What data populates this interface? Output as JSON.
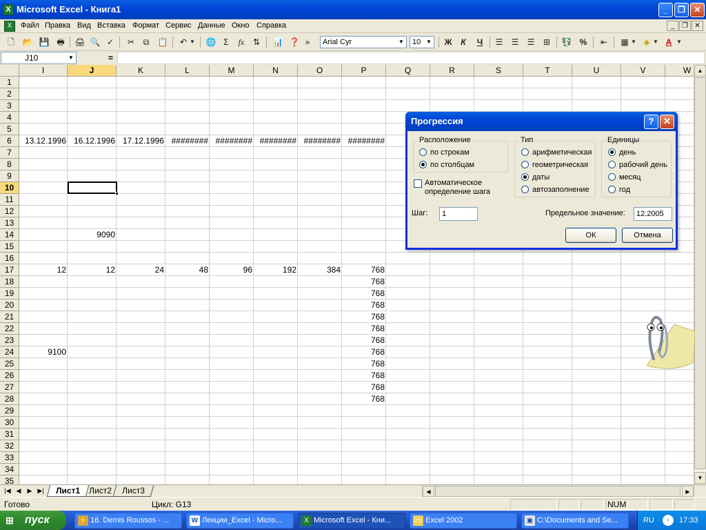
{
  "window": {
    "title": "Microsoft Excel - Книга1",
    "minimize": "_",
    "restore": "❐",
    "close": "✕"
  },
  "menu": {
    "items": [
      "Файл",
      "Правка",
      "Вид",
      "Вставка",
      "Формат",
      "Сервис",
      "Данные",
      "Окно",
      "Справка"
    ],
    "mdi": [
      "_",
      "❐",
      "✕"
    ]
  },
  "toolbar": {
    "font_name": "Arial Cyr",
    "font_size": "10",
    "bold": "Ж",
    "italic": "К",
    "underline": "Ч",
    "sum": "Σ",
    "fx": "fx",
    "percent": "%",
    "chevron": "»"
  },
  "formula_bar": {
    "cell_ref": "J10",
    "equals": "=",
    "value": ""
  },
  "grid": {
    "columns": [
      "I",
      "J",
      "K",
      "L",
      "M",
      "N",
      "O",
      "P",
      "Q",
      "R",
      "S",
      "T",
      "U",
      "V",
      "W"
    ],
    "active_column": "J",
    "rows": [
      "1",
      "2",
      "3",
      "4",
      "5",
      "6",
      "7",
      "8",
      "9",
      "10",
      "11",
      "12",
      "13",
      "14",
      "15",
      "16",
      "17",
      "18",
      "19",
      "20",
      "21",
      "22",
      "23",
      "24",
      "25",
      "26",
      "27",
      "28",
      "29",
      "30",
      "31",
      "32",
      "33",
      "34",
      "35"
    ],
    "active_row": "10",
    "row6": [
      "13.12.1996",
      "16.12.1996",
      "17.12.1996",
      "########",
      "########",
      "########",
      "########",
      "########",
      "###"
    ],
    "row14_J": "9090",
    "row17": [
      "12",
      "12",
      "24",
      "48",
      "96",
      "192",
      "384",
      "768"
    ],
    "colP_rows18_28": [
      "768",
      "768",
      "768",
      "768",
      "768",
      "768",
      "768",
      "768",
      "768",
      "768",
      "768"
    ],
    "row24_I": "9100"
  },
  "sheets": {
    "tabs": [
      "Лист1",
      "Лист2",
      "Лист3"
    ],
    "active": "Лист1"
  },
  "status": {
    "ready": "Готово",
    "cycle": "Цикл: G13",
    "num": "NUM"
  },
  "dialog": {
    "title": "Прогрессия",
    "help": "?",
    "close": "✕",
    "layout_group": "Расположение",
    "layout_options": [
      "по строкам",
      "по столбцам"
    ],
    "layout_selected": 1,
    "type_group": "Тип",
    "type_options": [
      "арифметическая",
      "геометрическая",
      "даты",
      "автозаполнение"
    ],
    "type_selected": 2,
    "units_group": "Единицы",
    "units_options": [
      "день",
      "рабочий день",
      "месяц",
      "год"
    ],
    "units_selected": 0,
    "auto_step_line1": "Автоматическое",
    "auto_step_line2": "определение шага",
    "step_label": "Шаг:",
    "step_value": "1",
    "limit_label": "Предельное значение:",
    "limit_value": "12.2005",
    "ok": "ОК",
    "cancel": "Отмена"
  },
  "taskbar": {
    "start": "пуск",
    "items": [
      "16. Demis Roussos - ...",
      "Лекции_Excel - Micro...",
      "Microsoft Excel - Кни...",
      "Excel 2002",
      "C:\\Documents and Se..."
    ],
    "active_index": 2,
    "lang": "RU",
    "clock": "17:33"
  }
}
